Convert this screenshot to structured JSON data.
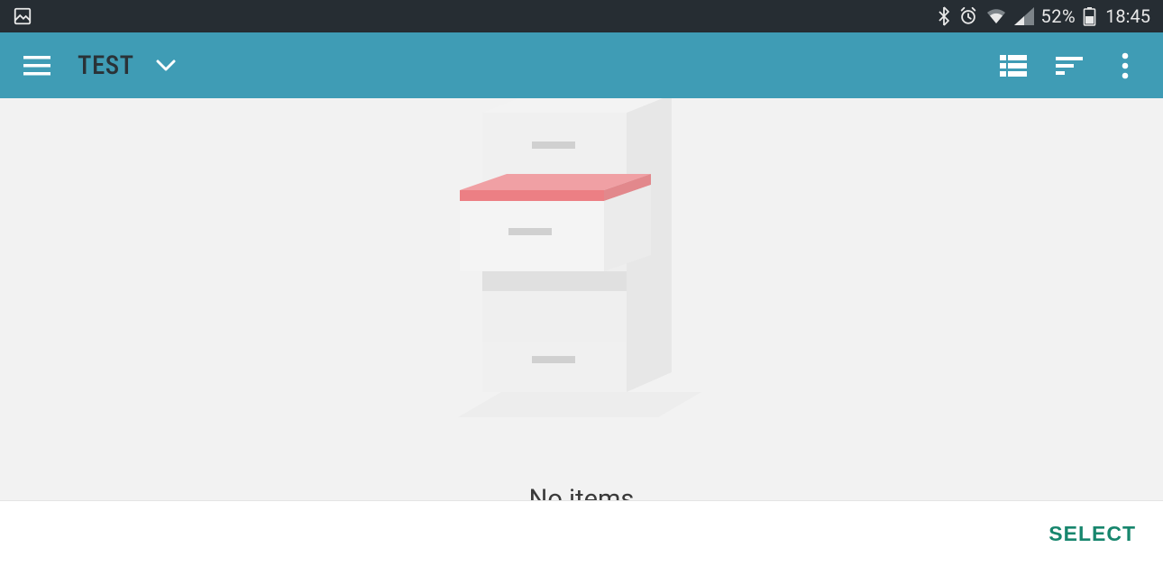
{
  "status_bar": {
    "battery_pct": "52%",
    "time": "18:45"
  },
  "app_bar": {
    "title": "TEST"
  },
  "empty_state": {
    "message": "No items"
  },
  "bottom_bar": {
    "select_label": "SELECT"
  }
}
